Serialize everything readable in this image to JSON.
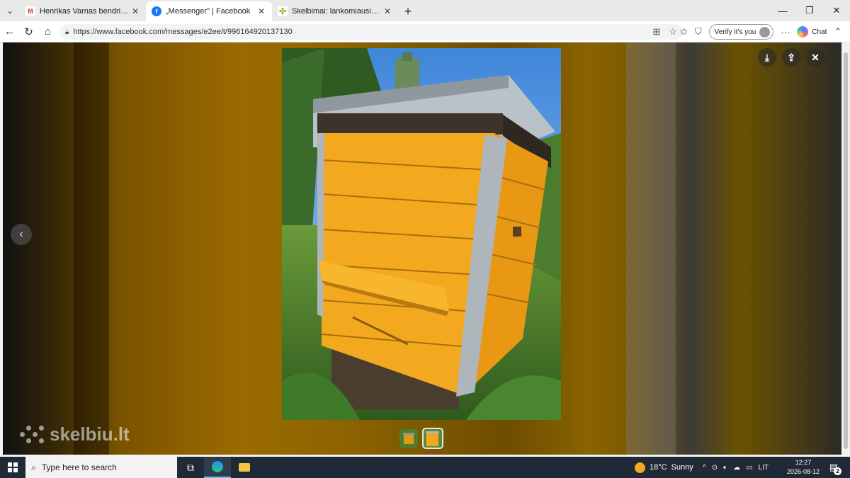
{
  "browser": {
    "tabs": [
      {
        "title": "Henrikas Varnas bendrino nuo",
        "favicon": "gmail-icon",
        "color": "#d93025",
        "fav_text": "M"
      },
      {
        "title": "„Messenger\" | Facebook",
        "favicon": "facebook-icon",
        "color": "#1877f2",
        "fav_text": "f"
      },
      {
        "title": "Skelbimai: lankomiausias Lietuvoje",
        "favicon": "skelbiu-icon",
        "color": "#7cb518",
        "fav_text": "✣"
      }
    ],
    "active_tab": 1,
    "url": "https://www.facebook.com/messages/e2ee/t/996164920137130",
    "verify_label": "Verify it's you",
    "chat_label": "Chat"
  },
  "viewer": {
    "watermark": "skelbiu.lt",
    "thumbnail_count": 2,
    "selected_thumbnail": 1
  },
  "taskbar": {
    "search_placeholder": "Type here to search",
    "weather_temp": "18°C",
    "weather_text": "Sunny",
    "language": "LIT",
    "time": "12:27",
    "date": "2026-08-12",
    "notifications": "2"
  }
}
